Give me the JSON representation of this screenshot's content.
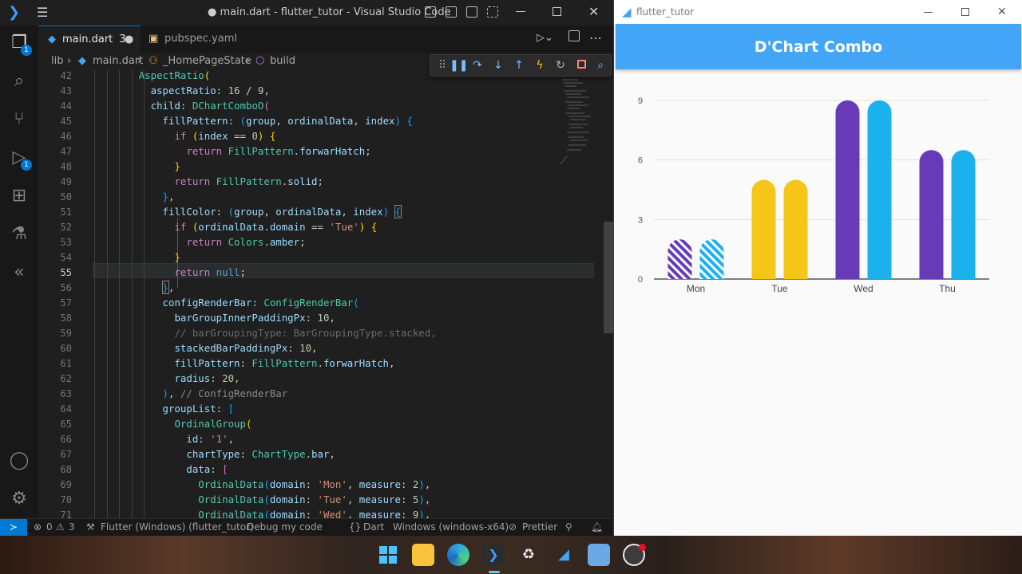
{
  "vscode": {
    "title": "● main.dart - flutter_tutor - Visual Studio Code",
    "tabs": [
      {
        "label": "main.dart",
        "badge": "3",
        "modified": true
      },
      {
        "label": "pubspec.yaml"
      }
    ],
    "breadcrumb": [
      "lib",
      "main.dart",
      "_HomePageState",
      "build"
    ],
    "activity_badges": {
      "explorer": "1",
      "run": "1"
    },
    "lines": [
      "42",
      "43",
      "44",
      "45",
      "46",
      "47",
      "48",
      "49",
      "50",
      "51",
      "52",
      "53",
      "54",
      "55",
      "56",
      "57",
      "58",
      "59",
      "60",
      "61",
      "62",
      "63",
      "64",
      "65",
      "66",
      "67",
      "68",
      "69",
      "70",
      "71"
    ],
    "status": {
      "errors": "0",
      "warnings": "3",
      "flutter": "Flutter (Windows) (flutter_tutor)",
      "debug": "Debug my code",
      "language": "Dart",
      "device": "Windows (windows-x64)",
      "prettier": "Prettier"
    }
  },
  "flutter": {
    "window_title": "flutter_tutor",
    "appbar_title": "D'Chart Combo"
  },
  "chart_data": {
    "type": "bar",
    "categories": [
      "Mon",
      "Tue",
      "Wed",
      "Thu"
    ],
    "series": [
      {
        "values": [
          2,
          5,
          9,
          6.5
        ]
      },
      {
        "values": [
          2,
          5,
          9,
          6.5
        ]
      }
    ],
    "yticks": [
      "0",
      "3",
      "6",
      "9"
    ],
    "ylim": [
      0,
      9
    ],
    "grid": true,
    "colors": {
      "series1": "#673ab7",
      "series2": "#1ab1ec",
      "tue": "#f5c518",
      "mon_pattern": "hatch"
    }
  }
}
